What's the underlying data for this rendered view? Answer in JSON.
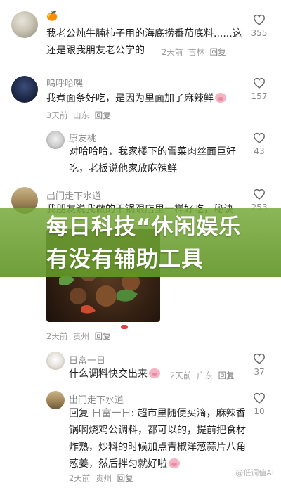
{
  "comments": [
    {
      "username": "🍊",
      "text": "我老公炖牛腩柿子用的海底捞番茄底料......这还是跟我朋友老公学的",
      "time": "2天前",
      "location": "吉林",
      "reply": "回复",
      "likes": "355"
    },
    {
      "username": "呜呼哈嘿",
      "text": "我煮面条好吃，是因为里面加了麻辣鲜",
      "time": "3天前",
      "location": "山东",
      "reply": "回复",
      "likes": "157"
    },
    {
      "username": "原友桃",
      "text": "对哈哈哈，我家楼下的雪菜肉丝面巨好吃，老板说他家放麻辣鲜",
      "likes": "43"
    },
    {
      "username": "出门走下水道",
      "text": "我朋友说我做的干锅跟店里一样好吃，秘诀",
      "time": "2天前",
      "location": "贵州",
      "reply": "回复",
      "likes": "253"
    },
    {
      "username": "日富一日",
      "text": "什么调料快交出来",
      "time": "2天前",
      "location": "广东",
      "reply": "回复",
      "likes": "37"
    },
    {
      "username": "出门走下水道",
      "reply_prefix": "回复",
      "mention": "日富一日",
      "text": ": 超市里随便买滴，麻辣香锅啊烧鸡公调料，都可以的，提前把食材炸熟，炒料的时候加点青椒洋葱蒜片八角葱姜，然后拌匀就好啦",
      "time": "2天前",
      "location": "贵州",
      "reply": "回复",
      "likes": "10"
    }
  ],
  "banner": {
    "text": "每日科技“休闲娱乐有没有辅助工具"
  },
  "watermark": "@低调值AI",
  "colors": {
    "banner_green": "#7aa83c",
    "pig_pink": "#f6b3c3",
    "meta_gray": "#9a9a9a"
  },
  "icons": [
    "heart-icon",
    "pig-emoji-icon",
    "avatar-image"
  ]
}
